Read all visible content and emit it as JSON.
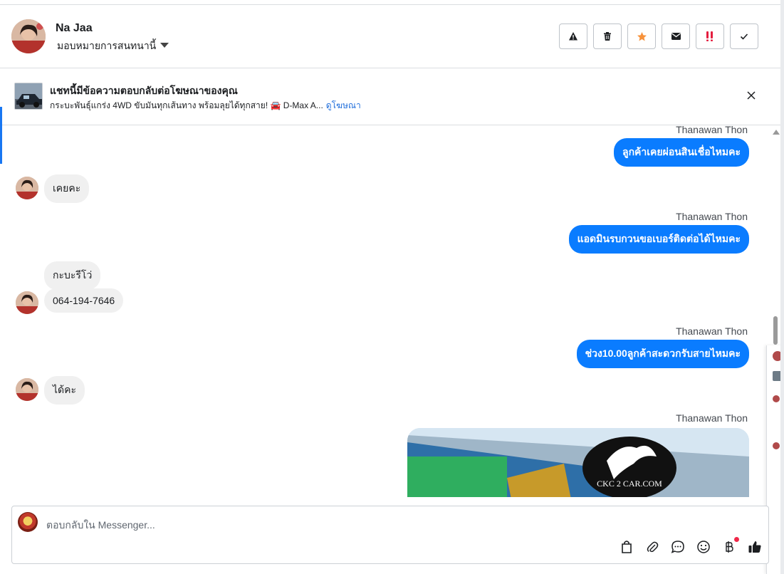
{
  "header": {
    "name": "Na Jaa",
    "assign_label": "มอบหมายการสนทนานี้",
    "actions": [
      {
        "icon": "warning-icon"
      },
      {
        "icon": "trash-icon"
      },
      {
        "icon": "star-icon"
      },
      {
        "icon": "mail-icon"
      },
      {
        "icon": "spam-icon"
      },
      {
        "icon": "check-icon"
      }
    ]
  },
  "ad": {
    "title": "แชทนี้มีข้อความตอบกลับต่อโฆษณาของคุณ",
    "subtitle": "กระบะพันธุ์แกร่ง 4WD ขับมันทุกเส้นทาง พร้อมลุยได้ทุกสาย! 🚘 D-Max A...",
    "link_label": "ดูโฆษณา"
  },
  "messages": [
    {
      "sender": "Thanawan Thon",
      "text": "ลูกค้าเคยผ่อนสินเชื่อไหมคะ"
    },
    {
      "text": "เคยคะ"
    },
    {
      "sender": "Thanawan Thon",
      "text": "แอดมินรบกวนขอเบอร์ติดต่อได้ไหมคะ"
    },
    {
      "text": "กะบะรีโว่"
    },
    {
      "text": "064-194-7646"
    },
    {
      "sender": "Thanawan Thon",
      "text": "ช่วง10.00ลูกค้าสะดวกรับสายไหมคะ"
    },
    {
      "text": "ได้คะ"
    },
    {
      "sender": "Thanawan Thon",
      "image_logo_text": "CKC 2 CAR.COM"
    }
  ],
  "composer": {
    "placeholder": "ตอบกลับใน Messenger...",
    "tools": [
      "bag-icon",
      "paperclip-icon",
      "chat-bubble-icon",
      "emoji-icon",
      "baht-icon",
      "thumbs-up-icon"
    ]
  },
  "colors": {
    "accent": "#0a7cff",
    "incoming_bubble": "#f0f0f0",
    "star": "#f7923b",
    "spam": "#e41e3f"
  }
}
